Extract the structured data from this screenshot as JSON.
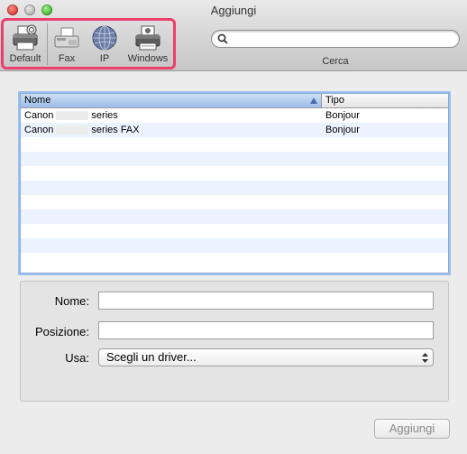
{
  "window": {
    "title": "Aggiungi"
  },
  "toolbar": {
    "items": [
      {
        "label": "Default",
        "icon": "printer-icon"
      },
      {
        "label": "Fax",
        "icon": "fax-icon"
      },
      {
        "label": "IP",
        "icon": "globe-network-icon"
      },
      {
        "label": "Windows",
        "icon": "windows-printer-icon"
      }
    ],
    "search": {
      "caption": "Cerca",
      "value": "",
      "placeholder": ""
    }
  },
  "printer_list": {
    "columns": [
      "Nome",
      "Tipo"
    ],
    "rows": [
      {
        "name_prefix": "Canon",
        "name_suffix": "series",
        "type": "Bonjour"
      },
      {
        "name_prefix": "Canon",
        "name_suffix": "series FAX",
        "type": "Bonjour"
      }
    ]
  },
  "details": {
    "name_label": "Nome:",
    "name_value": "",
    "location_label": "Posizione:",
    "location_value": "",
    "use_label": "Usa:",
    "use_selected": "Scegli un driver..."
  },
  "footer": {
    "add_button": "Aggiungi"
  },
  "colors": {
    "highlight": "#ec3f6a",
    "selection_header": "#9cbce8",
    "row_alt": "#edf3fe"
  }
}
